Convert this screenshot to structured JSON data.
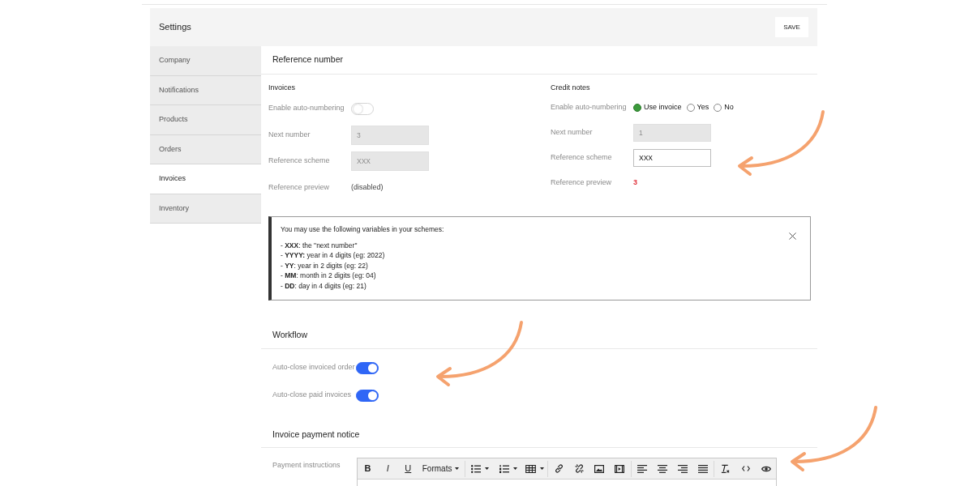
{
  "header": {
    "title": "Settings",
    "save_label": "SAVE"
  },
  "sidebar": {
    "items": [
      {
        "label": "Company",
        "selected": false
      },
      {
        "label": "Notifications",
        "selected": false
      },
      {
        "label": "Products",
        "selected": false
      },
      {
        "label": "Orders",
        "selected": false
      },
      {
        "label": "Invoices",
        "selected": true
      },
      {
        "label": "Inventory",
        "selected": false
      }
    ]
  },
  "reference_number": {
    "title": "Reference number",
    "invoices": {
      "title": "Invoices",
      "auto_numbering": {
        "label": "Enable auto-numbering",
        "on": false
      },
      "next_number": {
        "label": "Next number",
        "value": "3",
        "disabled": true
      },
      "reference_scheme": {
        "label": "Reference scheme",
        "value": "XXX",
        "disabled": true
      },
      "reference_preview": {
        "label": "Reference preview",
        "value": "(disabled)"
      }
    },
    "credit_notes": {
      "title": "Credit notes",
      "auto_numbering": {
        "label": "Enable auto-numbering",
        "options": [
          {
            "label": "Use invoice",
            "selected": true
          },
          {
            "label": "Yes",
            "selected": false
          },
          {
            "label": "No",
            "selected": false
          }
        ]
      },
      "next_number": {
        "label": "Next number",
        "value": "1",
        "disabled": true
      },
      "reference_scheme": {
        "label": "Reference scheme",
        "value": "XXX",
        "disabled": false
      },
      "reference_preview": {
        "label": "Reference preview",
        "value": "3"
      }
    },
    "variables_note": {
      "intro": "You may use the following variables in your schemes:",
      "lines": [
        "- **XXX**: the \"next number\"",
        "- **YYYY:** year in 4 digits (eg: 2022)",
        "- **YY**: year in 2 digits (eg: 22)",
        "- **MM**: month in 2 digits (eg: 04)",
        "- **DD**: day in 4 digits (eg: 21)"
      ]
    }
  },
  "workflow": {
    "title": "Workflow",
    "toggles": [
      {
        "label": "Auto-close invoiced order",
        "on": true
      },
      {
        "label": "Auto-close paid invoices",
        "on": true
      }
    ]
  },
  "payment_notice": {
    "title": "Invoice payment notice",
    "field_label": "Payment instructions",
    "toolbar": {
      "style_buttons": [
        "B",
        "I",
        "U"
      ],
      "formats_menu": "Formats"
    }
  }
}
